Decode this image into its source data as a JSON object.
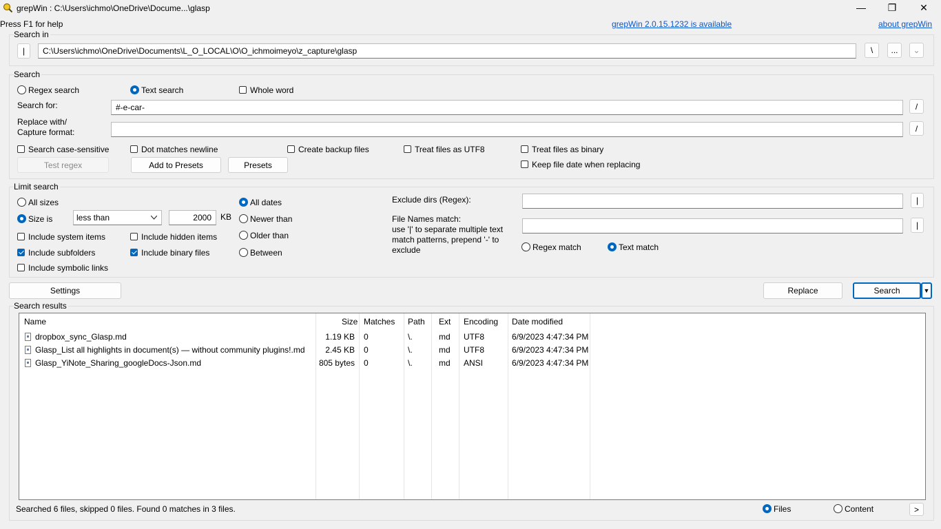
{
  "window": {
    "title": "grepWin : C:\\Users\\ichmo\\OneDrive\\Docume...\\glasp",
    "minimize_icon": "—",
    "maximize_icon": "❐",
    "close_icon": "✕"
  },
  "header": {
    "help_text": "Press F1 for help",
    "update_link": "grepWin 2.0.15.1232 is available",
    "about_link": "about grepWin"
  },
  "search_in": {
    "label": "Search in",
    "left_button": "|",
    "path": "C:\\Users\\ichmo\\OneDrive\\Documents\\L_O_LOCAL\\O\\O_ichmoimeyo\\z_capture\\glasp",
    "backslash_button": "\\",
    "browse_button": "...",
    "history_button": "⌄"
  },
  "search": {
    "label": "Search",
    "regex_radio": "Regex search",
    "text_radio": "Text search",
    "whole_word": "Whole word",
    "search_for_label": "Search for:",
    "search_for_value": "#-e-car-",
    "slash_button": "/",
    "replace_label_1": "Replace with/",
    "replace_label_2": "Capture format:",
    "replace_value": "",
    "replace_slash_button": "/",
    "case_sensitive": "Search case-sensitive",
    "dot_newline": "Dot matches newline",
    "create_backup": "Create backup files",
    "treat_utf8": "Treat files as UTF8",
    "treat_binary": "Treat files as binary",
    "keep_date": "Keep file date when replacing",
    "test_regex": "Test regex",
    "add_presets": "Add to Presets",
    "presets": "Presets"
  },
  "limit": {
    "label": "Limit search",
    "all_sizes": "All sizes",
    "size_is": "Size is",
    "size_op": "less than",
    "size_value": "2000",
    "size_unit": "KB",
    "all_dates": "All dates",
    "newer_than": "Newer than",
    "older_than": "Older than",
    "between": "Between",
    "include_system": "Include system items",
    "include_hidden": "Include hidden items",
    "include_subfolders": "Include subfolders",
    "include_binary": "Include binary files",
    "include_symlinks": "Include symbolic links",
    "exclude_dirs_label": "Exclude dirs (Regex):",
    "exclude_dirs_value": "",
    "exclude_btn": "|",
    "file_names_label": "File Names match:",
    "file_names_help_1": "use '|' to separate multiple text",
    "file_names_help_2": "match patterns, prepend '-' to",
    "file_names_help_3": "exclude",
    "file_names_value": "",
    "file_names_btn": "|",
    "regex_match": "Regex match",
    "text_match": "Text match"
  },
  "actions": {
    "settings": "Settings",
    "replace": "Replace",
    "search": "Search",
    "dropdown_arrow": "▼"
  },
  "results": {
    "label": "Search results",
    "columns": [
      "Name",
      "Size",
      "Matches",
      "Path",
      "Ext",
      "Encoding",
      "Date modified"
    ],
    "rows": [
      {
        "name": "dropbox_sync_Glasp.md",
        "size": "1.19 KB",
        "matches": "0",
        "path": "\\.",
        "ext": "md",
        "encoding": "UTF8",
        "date": "6/9/2023 4:47:34 PM"
      },
      {
        "name": "Glasp_List all highlights in document(s) — without community plugins!.md",
        "size": "2.45 KB",
        "matches": "0",
        "path": "\\.",
        "ext": "md",
        "encoding": "UTF8",
        "date": "6/9/2023 4:47:34 PM"
      },
      {
        "name": "Glasp_YiNote_Sharing_googleDocs-Json.md",
        "size": "805 bytes",
        "matches": "0",
        "path": "\\.",
        "ext": "md",
        "encoding": "ANSI",
        "date": "6/9/2023 4:47:34 PM"
      }
    ]
  },
  "status": {
    "text": "Searched 6 files, skipped 0 files. Found 0 matches in 3 files.",
    "files_radio": "Files",
    "content_radio": "Content",
    "expand_button": ">"
  }
}
